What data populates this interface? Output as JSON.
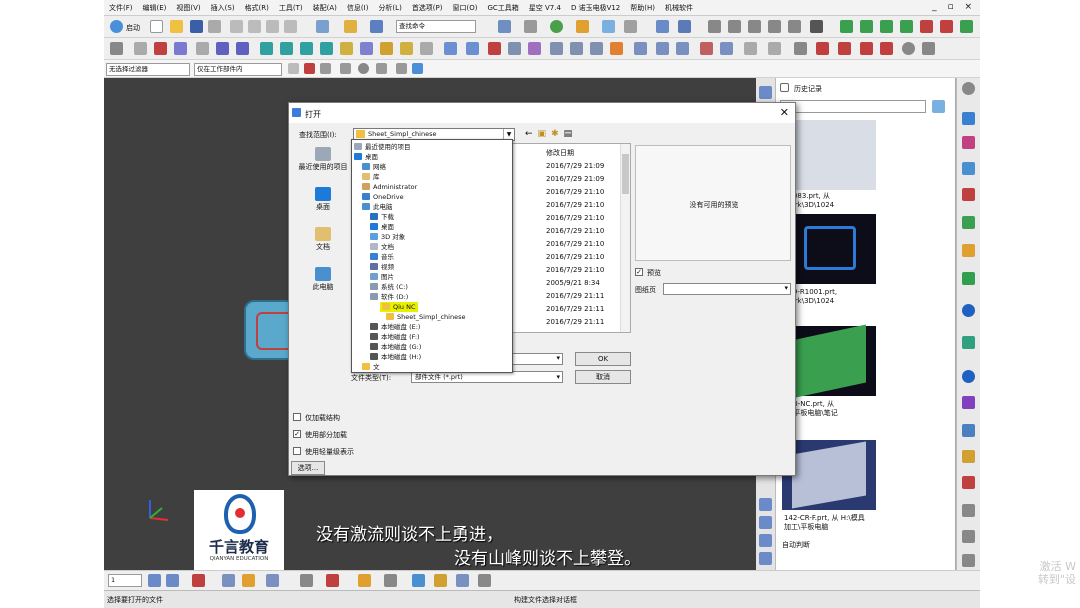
{
  "app": {
    "menu": [
      "文件(F)",
      "编辑(E)",
      "视图(V)",
      "插入(S)",
      "格式(R)",
      "工具(T)",
      "装配(A)",
      "信息(I)",
      "分析(L)",
      "首选项(P)",
      "窗口(O)",
      "GC工具箱",
      "星空 V7.4",
      "D 诺玉电极V12",
      "帮助(H)",
      "机械软件"
    ],
    "window_controls": "_ ▫ ×"
  },
  "toolbar": {
    "start_label": "启动",
    "command_search": "查找命令",
    "filter_select": "无选择过滤器",
    "scope_select": "仅在工作部件内"
  },
  "dialog": {
    "title": "打开",
    "look_in_label": "查找范围(I):",
    "look_in_value": "Sheet_Simpl_chinese",
    "places": [
      "最近使用的项目",
      "桌面",
      "文档",
      "此电脑"
    ],
    "column_modified": "修改日期",
    "dates": [
      "2016/7/29 21:09",
      "2016/7/29 21:09",
      "2016/7/29 21:10",
      "2016/7/29 21:10",
      "2016/7/29 21:10",
      "2016/7/29 21:10",
      "2016/7/29 21:10",
      "2016/7/29 21:10",
      "2016/7/29 21:10",
      "2005/9/21 8:34",
      "2016/7/29 21:11",
      "2016/7/29 21:11",
      "2016/7/29 21:11"
    ],
    "dropdown_items": [
      "最近使用的项目",
      "桌面",
      "网络",
      "库",
      "Administrator",
      "OneDrive",
      "此电脑",
      "下载",
      "桌面",
      "3D 对象",
      "文档",
      "音乐",
      "视频",
      "图片",
      "系统 (C:)",
      "软件 (D:)",
      "Qiu NC",
      "Sheet_Simpl_chinese",
      "本地磁盘 (E:)",
      "本地磁盘 (F:)",
      "本地磁盘 (G:)",
      "本地磁盘 (H:)",
      "文"
    ],
    "no_preview": "没有可用的预览",
    "preview_label": "预览",
    "page_label": "图纸页",
    "filetype_label": "文件类型(T):",
    "filetype_value": "部件文件 (*.prt)",
    "ok": "OK",
    "cancel": "取消",
    "opt_partial_struct": "仅加载结构",
    "opt_partial_load": "使用部分加载",
    "opt_lightweight": "使用轻量级表示",
    "options_btn": "选项..."
  },
  "history": {
    "title": "历史记录",
    "items": [
      {
        "caption1": "00083.prt, 从",
        "caption2": "Work\\3D\\1024"
      },
      {
        "caption1": "059-R1001.prt,",
        "caption2": "Work\\3D\\1024"
      },
      {
        "caption1": "A00-NC.prt, 从",
        "caption2": "工\\平板电脑\\笔记"
      },
      {
        "caption1": "142-CR-F.prt, 从 H:\\模具",
        "caption2": "加工\\平板电脑"
      }
    ],
    "auto_predict": "自动判断"
  },
  "bottom": {
    "layer_value": "1"
  },
  "status": {
    "left": "选择要打开的文件",
    "middle": "构建文件选择对话框"
  },
  "logo": {
    "cn": "千言教育",
    "en": "QIANYAN EDUCATION"
  },
  "subtitles": {
    "line1": "没有激流则谈不上勇进，",
    "line2": "没有山峰则谈不上攀登。"
  },
  "watermark": {
    "line1": "激活 W",
    "line2": "转到\"设"
  },
  "colors": {
    "canvas": "#3f3f3f",
    "dialog_bg": "#f0f0f0",
    "selection_highlight": "#e8f000",
    "logo_blue": "#1d5fb0"
  }
}
